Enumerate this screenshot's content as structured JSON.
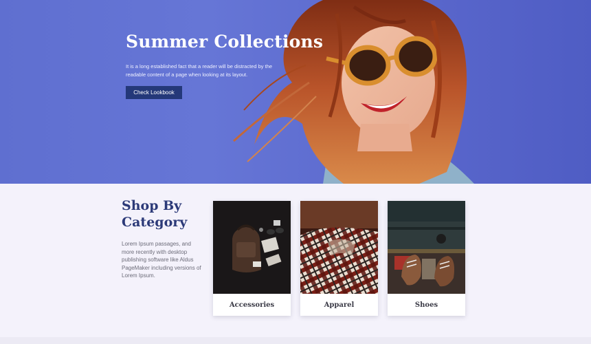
{
  "hero": {
    "title": "Summer Collections",
    "text": "It is a long established fact that a reader will be distracted by the readable content of a page when looking at its layout.",
    "button_label": "Check Lookbook",
    "background_color": "#5f6fd0",
    "button_color": "#243879"
  },
  "categories": {
    "heading": "Shop By Category",
    "description": "Lorem Ipsum passages, and more recently with desktop publishing software like Aldus PageMaker including versions of Lorem Ipsum.",
    "heading_color": "#2c3a78",
    "cards": [
      {
        "label": "Accessories"
      },
      {
        "label": "Apparel"
      },
      {
        "label": "Shoes"
      }
    ]
  }
}
